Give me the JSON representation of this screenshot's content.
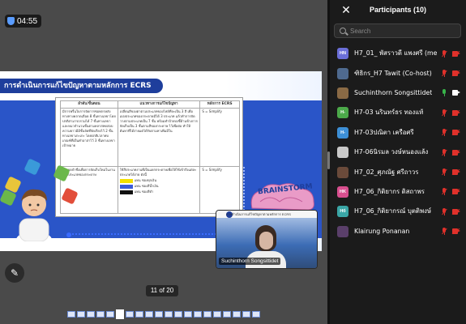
{
  "meeting": {
    "timer": "04:55",
    "page_indicator": "11 of 20"
  },
  "slide": {
    "title": "การดำเนินการแก้ไขปัญหาตามหลักการ ECRS",
    "table_headers": [
      "ลำดับ/ขั้นตอน",
      "แนวทางการแก้ไขปัญหา",
      "หลักการ ECRS"
    ],
    "rows": [
      {
        "col1": "มีการพริ้นใบการจัดการซอพกรหลังทางทางคลาดเลือด 8 ชั้นทางเลขาโดยปกติสามารถรวมได้ 7 ชั้นทางเลขา และหมวจำนวนชั้นตามคลาสทดสอบความยาวมีมีชั้นจัดที่จัดเรียงไว้ 2 ชั้นทางเลขาเกะเกะ โดยปกติเวลาพบเกณฑ์ที่เป็นคำอาสาไว้ 3 ชั้นทางเลขาเป้าหมาย",
        "col2": "เปลี่ยนสีของตาตามประเภทของไฟล์ที่จะเป็น 3 สี เพื่อแบ่งประเภทของกระดาษมีได้ 3 ประเภท แล้วทำการจัดวางตามประเภทเป็น 7 ชั้น พร้อมทำป้ายบ่งชี้ด้านข้างการจัดเก็บเป็น 3 ชั้นตามสีของกระดาษ ไว้เพื่อต่อ ทำให้ค้นหาที่ได้ง่ายแต่ได้รับตามหาเพิ่มมีใน",
        "col3": "S = Simplify"
      },
      {
        "col1": "การจดจำชื่อเพื่อการจัดเก็บใหม่ในงานของประเภทของกระดาษ",
        "col2": "ใช้สีประเภทงานที่เป็นแยกกระดาษเพื่อให้ใช้เข้าถึงแต่ละประเภทได้ง่าย ดังนี้",
        "col3": "S = Simplify"
      }
    ],
    "legend": [
      {
        "label": "แทน ซองทุกเงิน",
        "color": "#f4e000"
      },
      {
        "label": "แทน ซองสีน้ำเงิน",
        "color": "#3a5bd9"
      },
      {
        "label": "แทน ซองสีดำ",
        "color": "#111111"
      }
    ],
    "brainstorm_text": "BRAINSTORM"
  },
  "self_view": {
    "name": "Suchinthorn Songsittidet",
    "caption": "การดำเนินการแก้ไขปัญหาตามหลักการ ECRS"
  },
  "participants_panel": {
    "title": "Participants (10)",
    "search_placeholder": "Search",
    "participants": [
      {
        "initials": "HN",
        "name": "H7_01_ พัสราวดี แพงศรี (me)",
        "avatar_color": "#6b6fd8",
        "mic": "muted",
        "cam": "off"
      },
      {
        "initials": "",
        "name": "ฑิธิกร_H7 Tawit (Co-host)",
        "avatar_color": "#4f6a8f",
        "mic": "muted",
        "cam": "off",
        "photo": true
      },
      {
        "initials": "",
        "name": "Suchinthorn Songsittidet",
        "avatar_color": "#8a6a45",
        "mic": "on",
        "cam": "on",
        "photo": true
      },
      {
        "initials": "H-",
        "name": "H7-03 นรินทร์ธร ทองแท้",
        "avatar_color": "#4caa4a",
        "mic": "muted",
        "cam": "off"
      },
      {
        "initials": "H-",
        "name": "H7-03ปณิตา เครือศรี",
        "avatar_color": "#3d8fd6",
        "mic": "muted",
        "cam": "off"
      },
      {
        "initials": "",
        "name": "H7-06นิรมล วงษ์หนองแล้ง",
        "avatar_color": "#c9c9c9",
        "mic": "muted",
        "cam": "off",
        "photo": true
      },
      {
        "initials": "",
        "name": "H7_02_ศุภณัฐ ศรีถาวร",
        "avatar_color": "#6a4a3a",
        "mic": "muted",
        "cam": "off",
        "photo": true
      },
      {
        "initials": "HK",
        "name": "H7_06_กิติยากร ดิสถาพร",
        "avatar_color": "#d94f8f",
        "mic": "muted",
        "cam": "off"
      },
      {
        "initials": "Hб",
        "name": "H7_06_กิติยากรณ์ บุตติพงษ์",
        "avatar_color": "#3aa6a6",
        "mic": "muted",
        "cam": "off"
      },
      {
        "initials": "",
        "name": "Klairung Ponanan",
        "avatar_color": "#5a3f6a",
        "mic": "muted",
        "cam": "off",
        "photo": true
      }
    ]
  },
  "colors": {
    "muted": "#e0312b",
    "active_mic": "#38b44a",
    "active_cam": "#ffffff",
    "panel_bg": "#1b1b1b",
    "slide_header": "#1e3e9c"
  }
}
